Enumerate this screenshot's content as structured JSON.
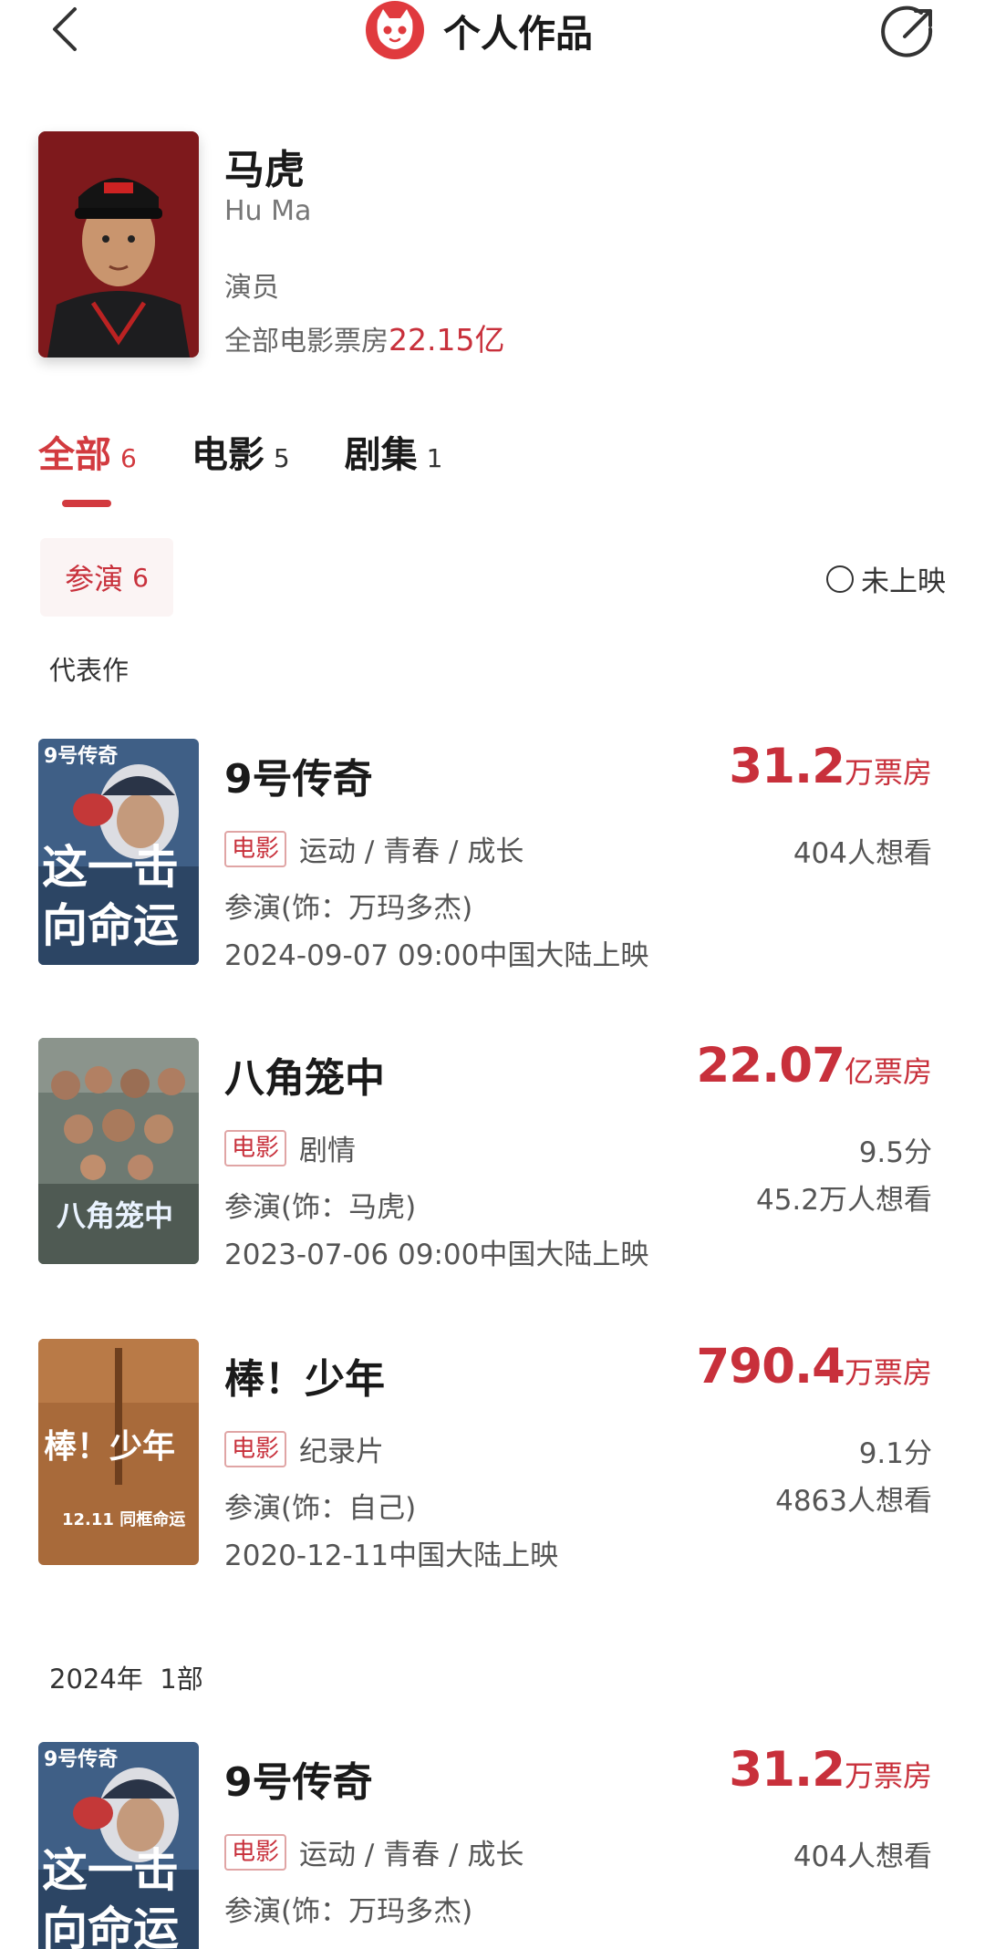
{
  "header": {
    "title": "个人作品",
    "back_icon": "chevron-left-icon",
    "share_icon": "share-icon",
    "logo_icon": "maoyan-cat-logo"
  },
  "profile": {
    "name": "马虎",
    "en_name": "Hu Ma",
    "role": "演员",
    "boxoffice_label": "全部电影票房",
    "boxoffice_value": "22.15亿"
  },
  "tabs": [
    {
      "label": "全部",
      "count": "6",
      "active": true
    },
    {
      "label": "电影",
      "count": "5",
      "active": false
    },
    {
      "label": "剧集",
      "count": "1",
      "active": false
    }
  ],
  "filter": {
    "chip_label": "参演",
    "chip_count": "6",
    "unreleased_label": "未上映"
  },
  "sections": {
    "representative": "代表作",
    "year_2024": "2024年",
    "year_2024_count": "1部"
  },
  "movies": [
    {
      "title": "9号传奇",
      "box_num": "31.2",
      "box_unit": "万票房",
      "tag": "电影",
      "genre": "运动 / 青春 / 成长",
      "role": "参演(饰：万玛多杰)",
      "release": "2024-09-07 09:00中国大陆上映",
      "right1": "404人想看",
      "right2": ""
    },
    {
      "title": "八角笼中",
      "box_num": "22.07",
      "box_unit": "亿票房",
      "tag": "电影",
      "genre": "剧情",
      "role": "参演(饰：马虎)",
      "release": "2023-07-06 09:00中国大陆上映",
      "right1": "9.5分",
      "right2": "45.2万人想看"
    },
    {
      "title": "棒！少年",
      "box_num": "790.4",
      "box_unit": "万票房",
      "tag": "电影",
      "genre": "纪录片",
      "role": "参演(饰：自己)",
      "release": "2020-12-11中国大陆上映",
      "right1": "9.1分",
      "right2": "4863人想看"
    },
    {
      "title": "9号传奇",
      "box_num": "31.2",
      "box_unit": "万票房",
      "tag": "电影",
      "genre": "运动 / 青春 / 成长",
      "role": "参演(饰：万玛多杰)",
      "release": "",
      "right1": "404人想看",
      "right2": ""
    }
  ],
  "poster_text": {
    "p1_top": "9号传奇",
    "p1_line1": "这一击",
    "p1_line2": "向命运",
    "p2_title": "八角笼中",
    "p3_title": "棒！少年",
    "p3_date": "12.11 同框命运"
  },
  "colors": {
    "accent": "#c8303b",
    "tab_active": "#d23a3f",
    "chip_bg": "#fbf4f4"
  }
}
